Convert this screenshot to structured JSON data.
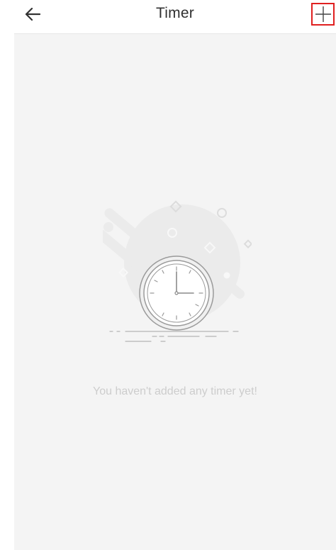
{
  "header": {
    "title": "Timer",
    "back_icon": "arrow-left-icon",
    "add_icon": "plus-icon"
  },
  "empty_state": {
    "illustration_icon": "clock-icon",
    "message": "You haven't added any timer yet!"
  },
  "colors": {
    "header_bg": "#ffffff",
    "content_bg": "#f4f4f4",
    "title_text": "#303030",
    "message_text": "#cdcdcd",
    "highlight_border": "#e02020"
  }
}
